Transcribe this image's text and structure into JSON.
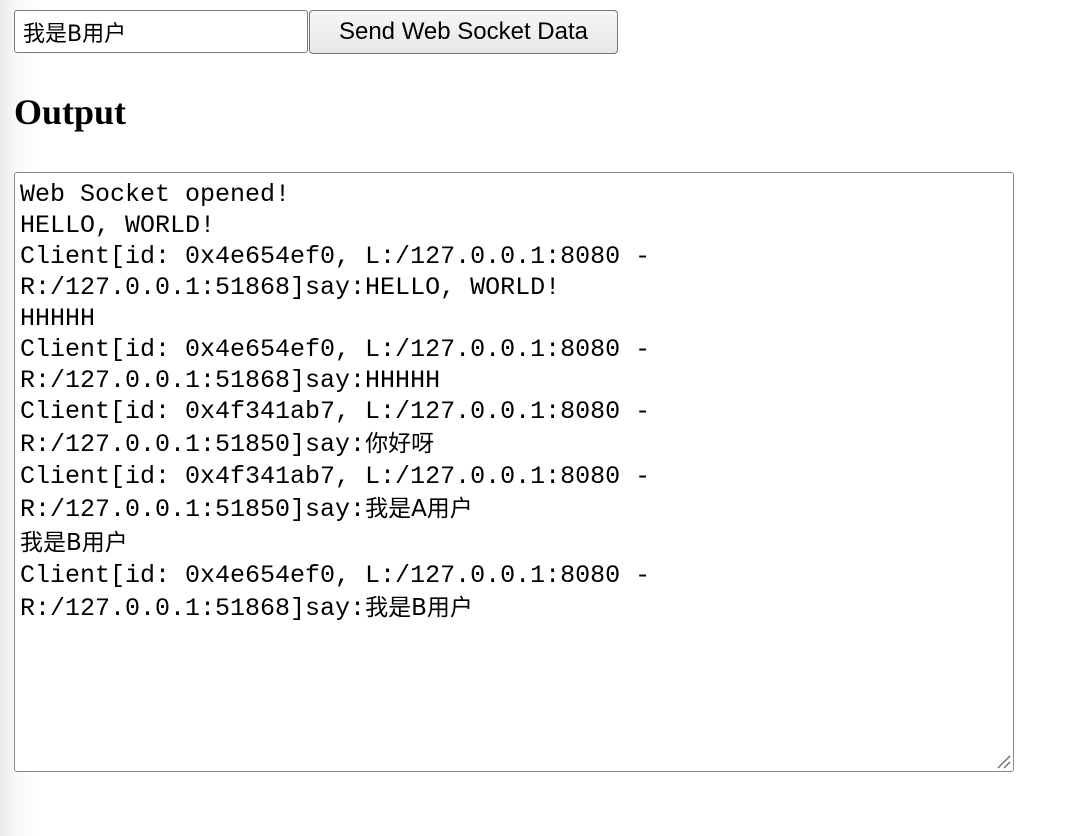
{
  "form": {
    "message_value": "我是B用户",
    "send_label": "Send Web Socket Data"
  },
  "heading": "Output",
  "output": {
    "lines": [
      {
        "mono": "Web Socket opened!",
        "cjk": ""
      },
      {
        "mono": "HELLO, WORLD!",
        "cjk": ""
      },
      {
        "mono": "Client[id: 0x4e654ef0, L:/127.0.0.1:8080 -",
        "cjk": ""
      },
      {
        "mono": "R:/127.0.0.1:51868]say:HELLO, WORLD!",
        "cjk": ""
      },
      {
        "mono": "HHHHH",
        "cjk": ""
      },
      {
        "mono": "Client[id: 0x4e654ef0, L:/127.0.0.1:8080 -",
        "cjk": ""
      },
      {
        "mono": "R:/127.0.0.1:51868]say:HHHHH",
        "cjk": ""
      },
      {
        "mono": "Client[id: 0x4f341ab7, L:/127.0.0.1:8080 -",
        "cjk": ""
      },
      {
        "mono": "R:/127.0.0.1:51850]say:",
        "cjk": "你好呀"
      },
      {
        "mono": "Client[id: 0x4f341ab7, L:/127.0.0.1:8080 -",
        "cjk": ""
      },
      {
        "mono": "R:/127.0.0.1:51850]say:",
        "cjk": "我是A用户"
      },
      {
        "mono": "",
        "cjk": "我是B用户"
      },
      {
        "mono": "Client[id: 0x4e654ef0, L:/127.0.0.1:8080 -",
        "cjk": ""
      },
      {
        "mono": "R:/127.0.0.1:51868]say:",
        "cjk": "我是B用户"
      }
    ]
  },
  "icons": {
    "resize": "resize-grip-icon"
  }
}
